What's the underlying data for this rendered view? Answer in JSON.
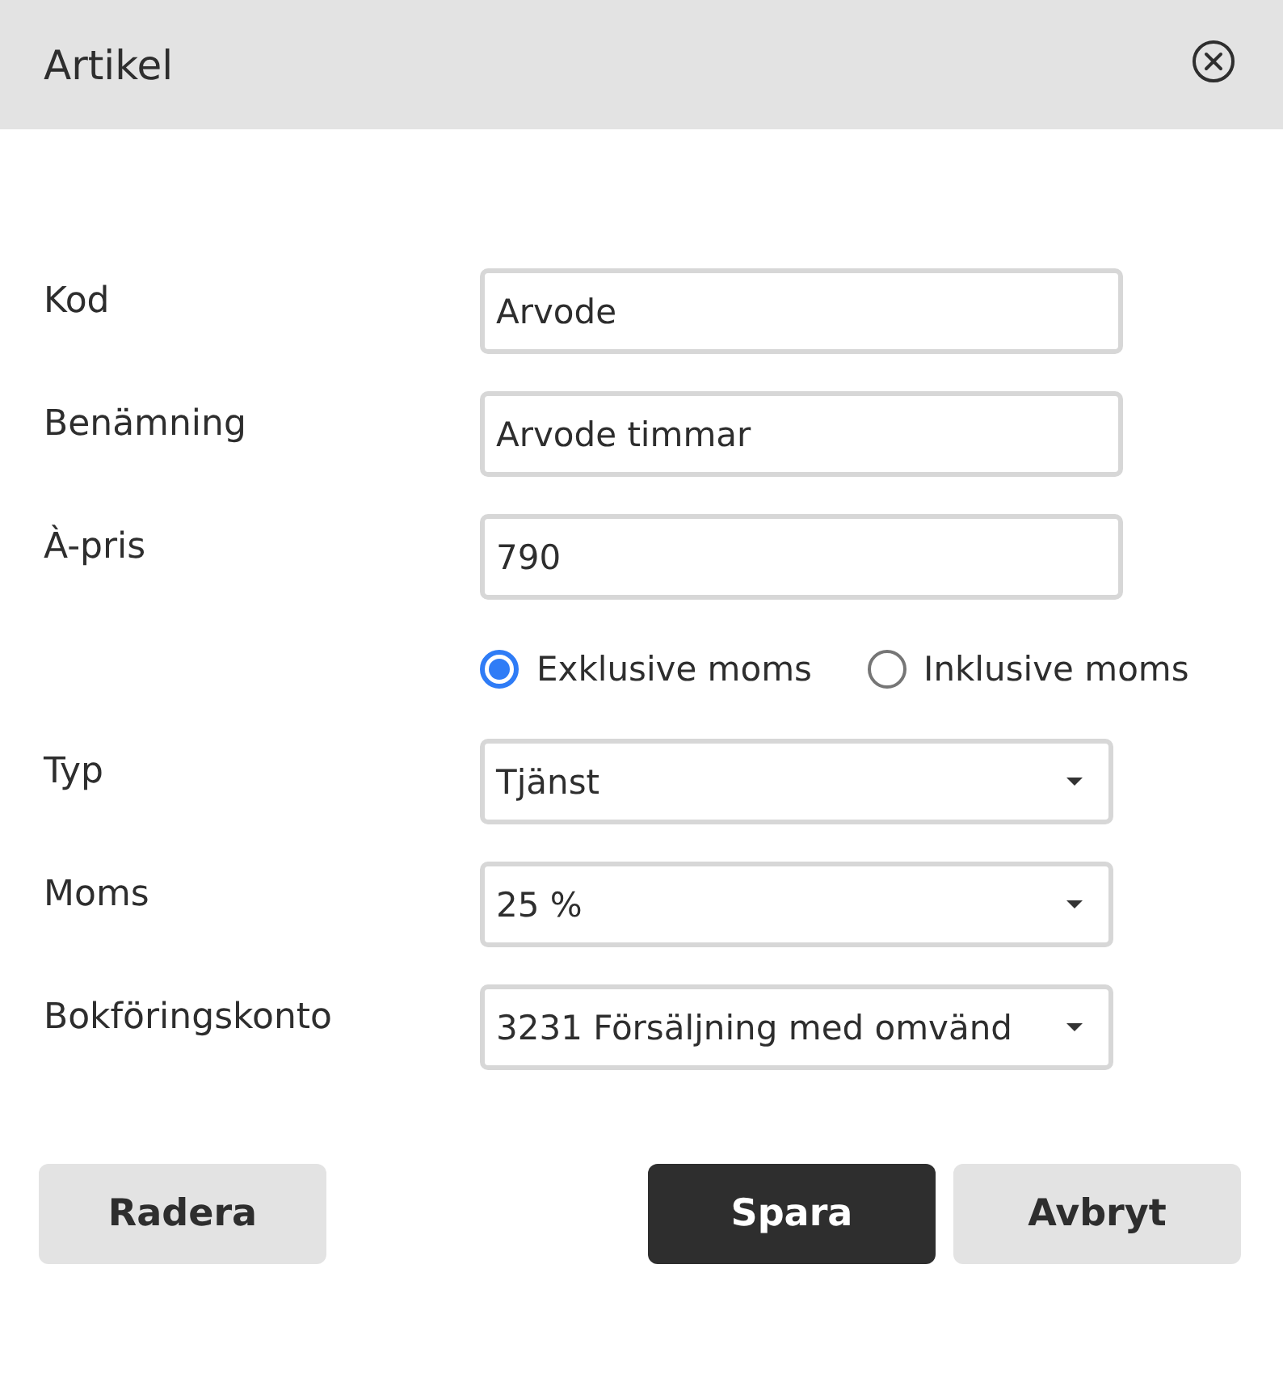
{
  "dialog": {
    "title": "Artikel"
  },
  "fields": [
    {
      "kind": "text",
      "label": "Kod",
      "value": "Arvode"
    },
    {
      "kind": "text",
      "label": "Benämning",
      "value": "Arvode timmar"
    },
    {
      "kind": "text",
      "label": "À-pris",
      "value": "790"
    },
    {
      "kind": "radio",
      "options": [
        {
          "label": "Exklusive moms",
          "selected": true
        },
        {
          "label": "Inklusive moms",
          "selected": false
        }
      ]
    },
    {
      "kind": "select",
      "label": "Typ",
      "value": "Tjänst"
    },
    {
      "kind": "select",
      "label": "Moms",
      "value": "25 %"
    },
    {
      "kind": "select",
      "label": "Bokföringskonto",
      "value": "3231 Försäljning med omvänd"
    }
  ],
  "left_buttons": [
    {
      "label": "Radera",
      "kind": "secondary"
    }
  ],
  "right_buttons": [
    {
      "label": "Spara",
      "kind": "primary"
    },
    {
      "label": "Avbryt",
      "kind": "secondary"
    }
  ]
}
